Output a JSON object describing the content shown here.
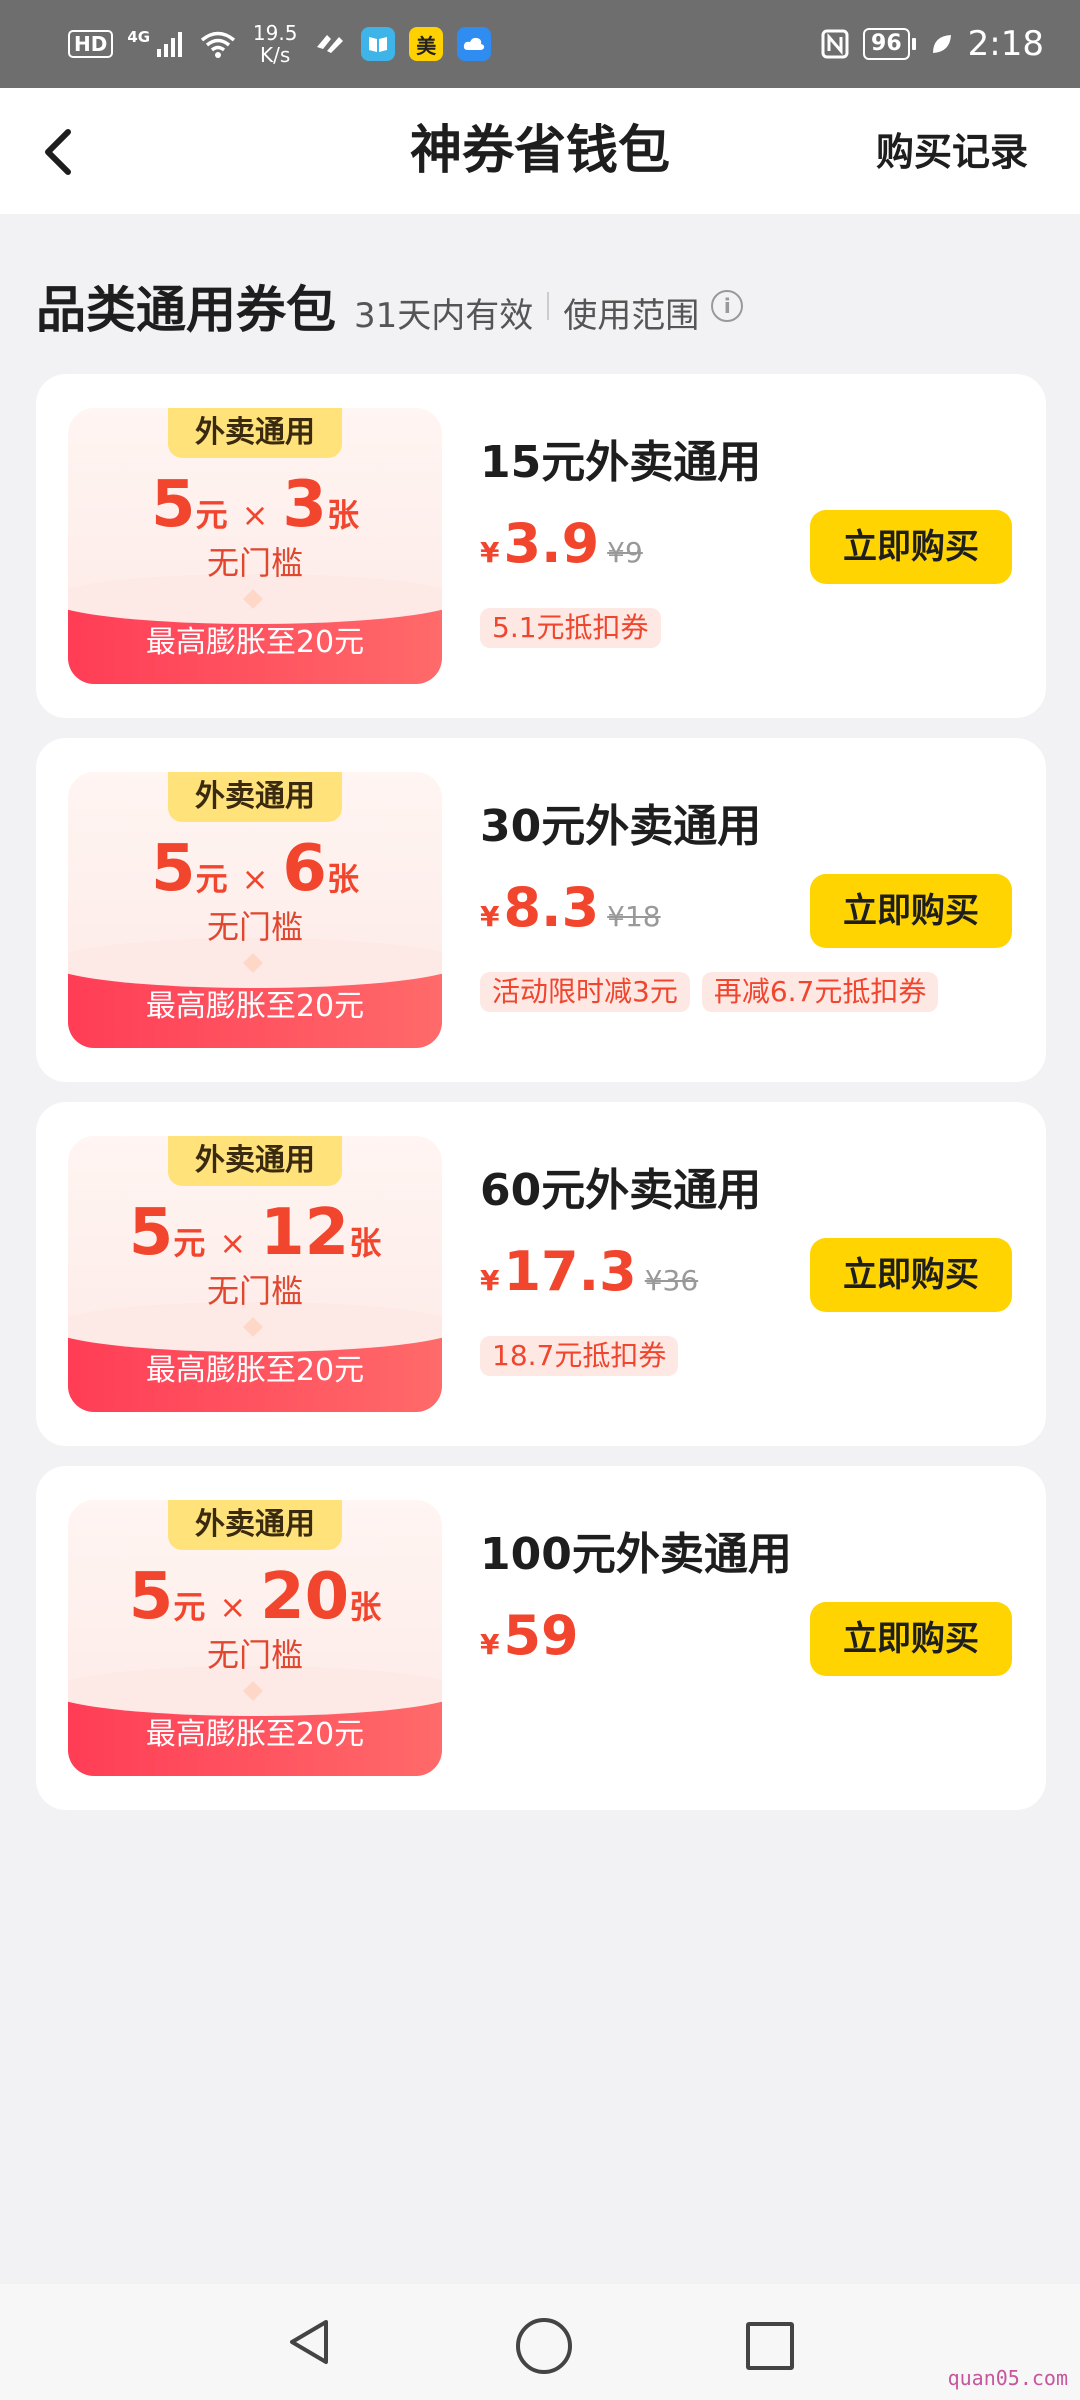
{
  "status_bar": {
    "hd": "HD",
    "network": "4G",
    "speed": "19.5 K/s",
    "app_icons": [
      "meituan-icon",
      "book-app-icon",
      "meituan-app-icon",
      "cloud-app-icon"
    ],
    "meituan_label": "美",
    "battery": "96",
    "time": "2:18"
  },
  "header": {
    "title": "神券省钱包",
    "records": "购买记录"
  },
  "section": {
    "title": "品类通用券包",
    "validity": "31天内有效",
    "scope": "使用范围",
    "info": "i"
  },
  "cards": [
    {
      "coupon": {
        "tag": "外卖通用",
        "value": "5",
        "unit": "元",
        "times": "×",
        "count": "3",
        "count_unit": "张",
        "threshold": "无门槛",
        "max": "最高膨胀至20元"
      },
      "title": "15元外卖通用",
      "price": "3.9",
      "currency": "¥",
      "original": "¥9",
      "button": "立即购买",
      "tags": [
        "5.1元抵扣券"
      ]
    },
    {
      "coupon": {
        "tag": "外卖通用",
        "value": "5",
        "unit": "元",
        "times": "×",
        "count": "6",
        "count_unit": "张",
        "threshold": "无门槛",
        "max": "最高膨胀至20元"
      },
      "title": "30元外卖通用",
      "price": "8.3",
      "currency": "¥",
      "original": "¥18",
      "button": "立即购买",
      "tags": [
        "活动限时减3元",
        "再减6.7元抵扣券"
      ]
    },
    {
      "coupon": {
        "tag": "外卖通用",
        "value": "5",
        "unit": "元",
        "times": "×",
        "count": "12",
        "count_unit": "张",
        "threshold": "无门槛",
        "max": "最高膨胀至20元"
      },
      "title": "60元外卖通用",
      "price": "17.3",
      "currency": "¥",
      "original": "¥36",
      "button": "立即购买",
      "tags": [
        "18.7元抵扣券"
      ]
    },
    {
      "coupon": {
        "tag": "外卖通用",
        "value": "5",
        "unit": "元",
        "times": "×",
        "count": "20",
        "count_unit": "张",
        "threshold": "无门槛",
        "max": "最高膨胀至20元"
      },
      "title": "100元外卖通用",
      "price": "59",
      "currency": "¥",
      "original": "",
      "button": "立即购买",
      "tags": []
    }
  ],
  "watermark": "quan05.com",
  "colors": {
    "accent": "#f2452d",
    "button": "#ffd400",
    "coupon_bottom": "#ff3d56"
  }
}
